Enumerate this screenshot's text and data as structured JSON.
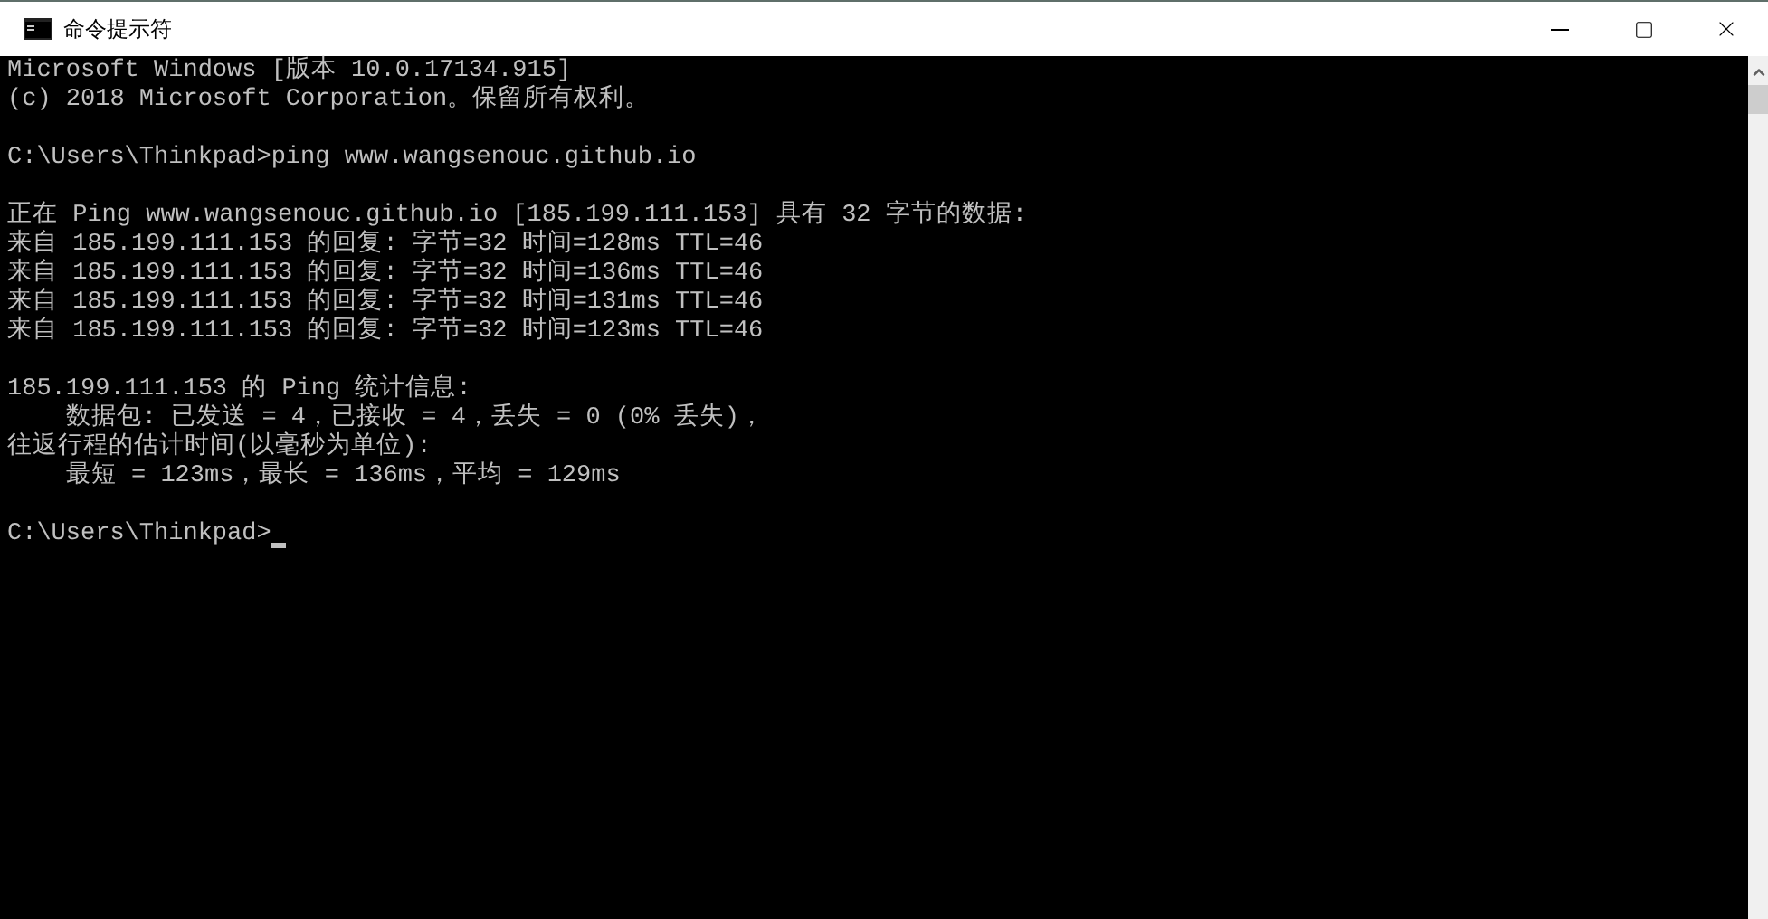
{
  "window": {
    "title": "命令提示符"
  },
  "console": {
    "blocks": [
      [
        "Microsoft Windows [版本 10.0.17134.915]",
        "(c) 2018 Microsoft Corporation。保留所有权利。"
      ],
      [
        "C:\\Users\\Thinkpad>ping www.wangsenouc.github.io"
      ],
      [
        "正在 Ping www.wangsenouc.github.io [185.199.111.153] 具有 32 字节的数据:",
        "来自 185.199.111.153 的回复: 字节=32 时间=128ms TTL=46",
        "来自 185.199.111.153 的回复: 字节=32 时间=136ms TTL=46",
        "来自 185.199.111.153 的回复: 字节=32 时间=131ms TTL=46",
        "来自 185.199.111.153 的回复: 字节=32 时间=123ms TTL=46"
      ],
      [
        "185.199.111.153 的 Ping 统计信息:",
        "    数据包: 已发送 = 4，已接收 = 4，丢失 = 0 (0% 丢失)，",
        "往返行程的估计时间(以毫秒为单位):",
        "    最短 = 123ms，最长 = 136ms，平均 = 129ms"
      ]
    ],
    "prompt": "C:\\Users\\Thinkpad>"
  }
}
